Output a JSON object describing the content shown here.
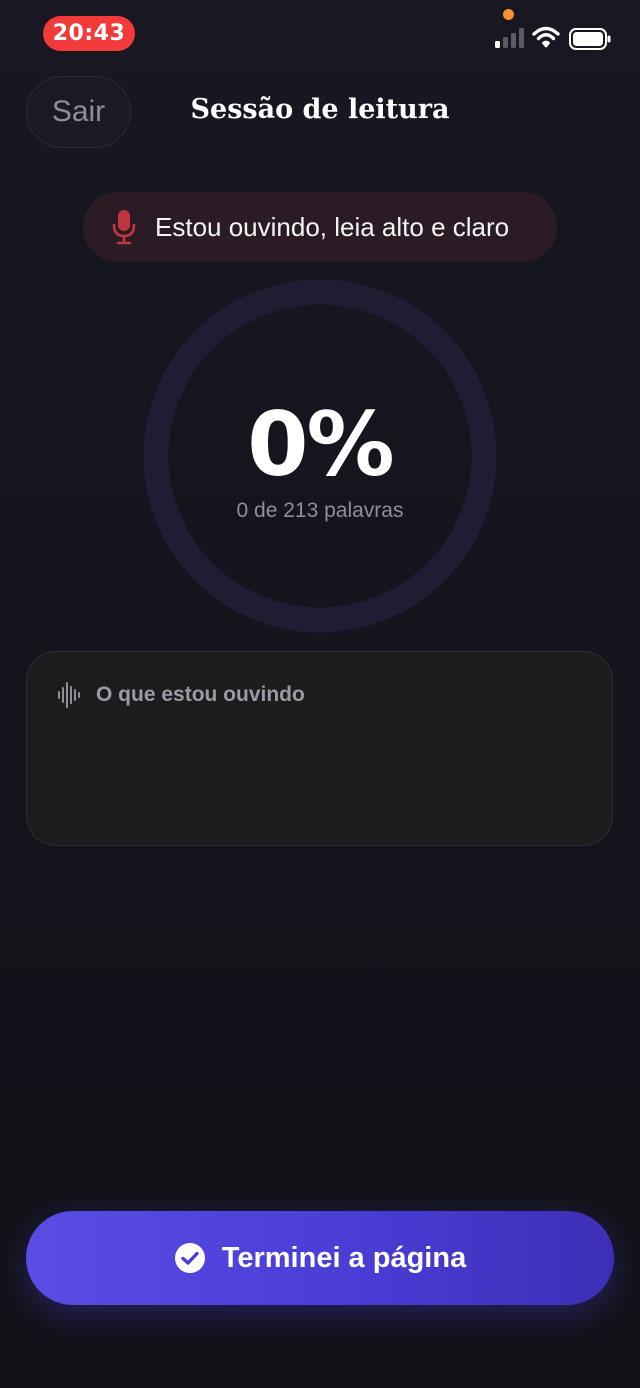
{
  "status_bar": {
    "time": "20:43",
    "time_pill_color": "#f23a3a",
    "privacy_dot_color": "#f5922f",
    "icons": [
      "signal-icon",
      "wifi-icon",
      "battery-icon"
    ]
  },
  "header": {
    "exit_label": "Sair",
    "title": "Sessão de leitura"
  },
  "listening": {
    "icon": "microphone-icon",
    "text": "Estou ouvindo, leia alto e claro"
  },
  "progress": {
    "percent_label": "0%",
    "progress_fraction": 0,
    "words_label": "0 de 213 palavras"
  },
  "transcript": {
    "icon": "audio-wave-icon",
    "label": "O que estou ouvindo",
    "content": ""
  },
  "finish": {
    "icon": "check-circle-icon",
    "label": "Terminei a página",
    "accent_color": "#5a4de3"
  }
}
